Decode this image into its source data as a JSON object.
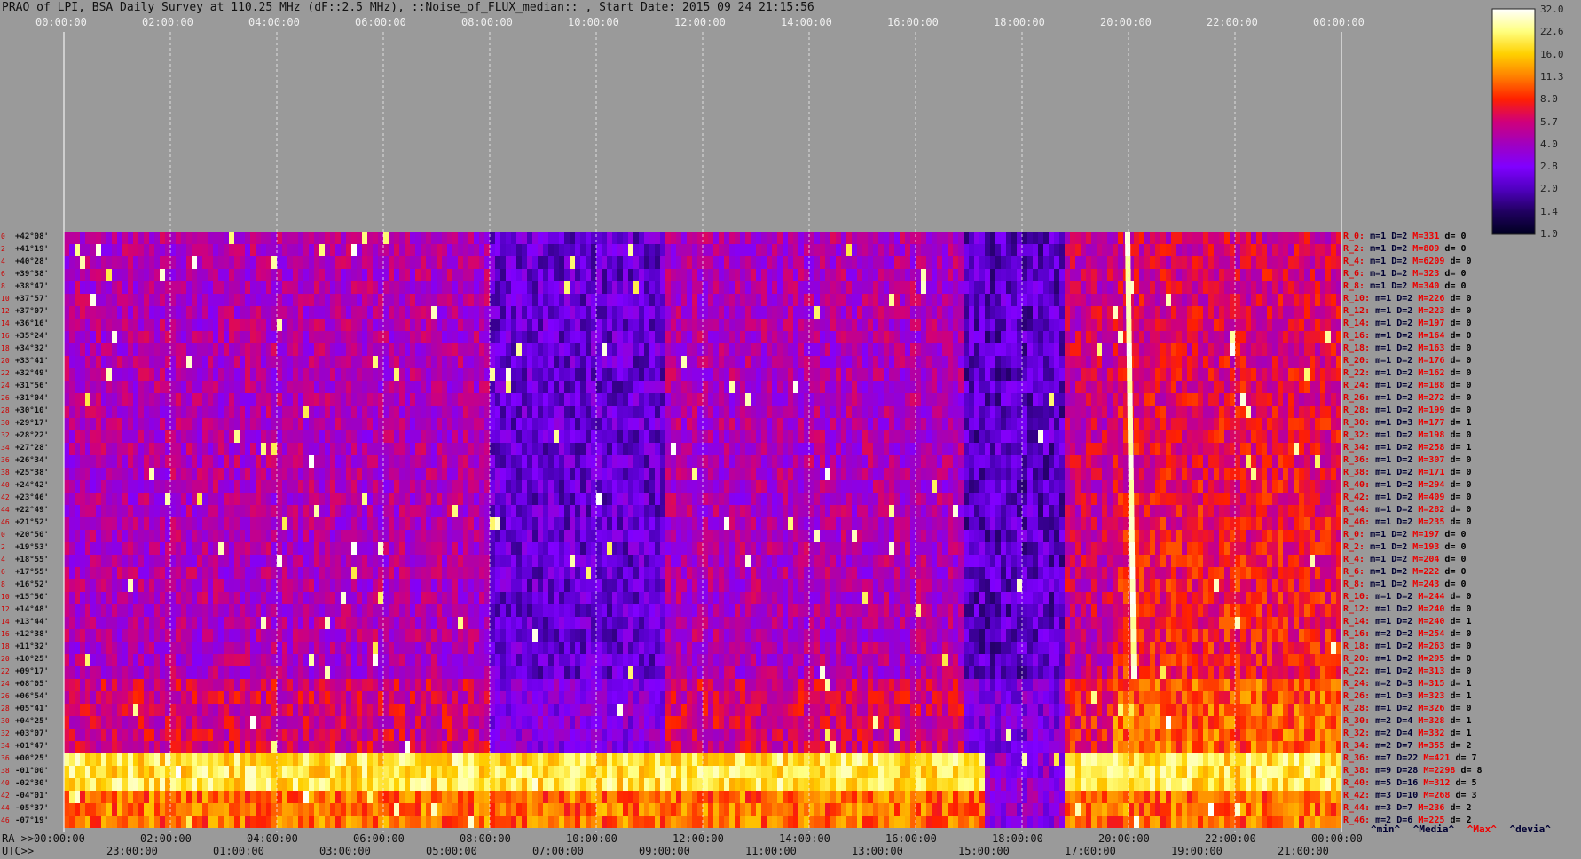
{
  "title": "PRAO of LPI, BSA Daily Survey at 110.25 MHz (dF::2.5 MHz), ::Noise_of_FLUX_median:: , Start Date: 2015 09 24 21:15:56",
  "top_axis_ticks": [
    "00:00:00",
    "02:00:00",
    "04:00:00",
    "06:00:00",
    "08:00:00",
    "10:00:00",
    "12:00:00",
    "14:00:00",
    "16:00:00",
    "18:00:00",
    "20:00:00",
    "22:00:00",
    "00:00:00"
  ],
  "bottom_axis": {
    "ra_prefix": "RA >>",
    "ra_ticks": [
      "00:00:00",
      "02:00:00",
      "04:00:00",
      "06:00:00",
      "08:00:00",
      "10:00:00",
      "12:00:00",
      "14:00:00",
      "16:00:00",
      "18:00:00",
      "20:00:00",
      "22:00:00",
      "00:00:00"
    ],
    "utc_prefix": "UTC>>",
    "utc_ticks": [
      "23:00:00",
      "01:00:00",
      "03:00:00",
      "05:00:00",
      "07:00:00",
      "09:00:00",
      "11:00:00",
      "13:00:00",
      "15:00:00",
      "17:00:00",
      "19:00:00",
      "21:00:00"
    ]
  },
  "row_numbers": [
    "0",
    "2",
    "4",
    "6",
    "8",
    "10",
    "12",
    "14",
    "16",
    "18",
    "20",
    "22",
    "24",
    "26",
    "28",
    "30",
    "32",
    "34",
    "36",
    "38",
    "40",
    "42",
    "44",
    "46",
    "0",
    "2",
    "4",
    "6",
    "8",
    "10",
    "12",
    "14",
    "16",
    "18",
    "20",
    "22",
    "24",
    "26",
    "28",
    "30",
    "32",
    "34",
    "36",
    "38",
    "40",
    "42",
    "44",
    "46"
  ],
  "declinations": [
    "+42°08'",
    "+41°19'",
    "+40°28'",
    "+39°38'",
    "+38°47'",
    "+37°57'",
    "+37°07'",
    "+36°16'",
    "+35°24'",
    "+34°32'",
    "+33°41'",
    "+32°49'",
    "+31°56'",
    "+31°04'",
    "+30°10'",
    "+29°17'",
    "+28°22'",
    "+27°28'",
    "+26°34'",
    "+25°38'",
    "+24°42'",
    "+23°46'",
    "+22°49'",
    "+21°52'",
    "+20°50'",
    "+19°53'",
    "+18°55'",
    "+17°55'",
    "+16°52'",
    "+15°50'",
    "+14°48'",
    "+13°44'",
    "+12°38'",
    "+11°32'",
    "+10°25'",
    "+09°17'",
    "+08°05'",
    "+06°54'",
    "+05°41'",
    "+04°25'",
    "+03°07'",
    "+01°47'",
    "+00°25'",
    "-01°00'",
    "-02°30'",
    "-04°01'",
    "-05°37'",
    "-07°19'"
  ],
  "stats": [
    {
      "r": "R_0:",
      "min": "m=1",
      "med": "D=2",
      "max": "M=331",
      "dev": "d= 0"
    },
    {
      "r": "R_2:",
      "min": "m=1",
      "med": "D=2",
      "max": "M=809",
      "dev": "d= 0"
    },
    {
      "r": "R_4:",
      "min": "m=1",
      "med": "D=2",
      "max": "M=6209",
      "dev": "d= 0"
    },
    {
      "r": "R_6:",
      "min": "m=1",
      "med": "D=2",
      "max": "M=323",
      "dev": "d= 0"
    },
    {
      "r": "R_8:",
      "min": "m=1",
      "med": "D=2",
      "max": "M=340",
      "dev": "d= 0"
    },
    {
      "r": "R_10:",
      "min": "m=1",
      "med": "D=2",
      "max": "M=226",
      "dev": "d= 0"
    },
    {
      "r": "R_12:",
      "min": "m=1",
      "med": "D=2",
      "max": "M=223",
      "dev": "d= 0"
    },
    {
      "r": "R_14:",
      "min": "m=1",
      "med": "D=2",
      "max": "M=197",
      "dev": "d= 0"
    },
    {
      "r": "R_16:",
      "min": "m=1",
      "med": "D=2",
      "max": "M=164",
      "dev": "d= 0"
    },
    {
      "r": "R_18:",
      "min": "m=1",
      "med": "D=2",
      "max": "M=163",
      "dev": "d= 0"
    },
    {
      "r": "R_20:",
      "min": "m=1",
      "med": "D=2",
      "max": "M=176",
      "dev": "d= 0"
    },
    {
      "r": "R_22:",
      "min": "m=1",
      "med": "D=2",
      "max": "M=162",
      "dev": "d= 0"
    },
    {
      "r": "R_24:",
      "min": "m=1",
      "med": "D=2",
      "max": "M=188",
      "dev": "d= 0"
    },
    {
      "r": "R_26:",
      "min": "m=1",
      "med": "D=2",
      "max": "M=272",
      "dev": "d= 0"
    },
    {
      "r": "R_28:",
      "min": "m=1",
      "med": "D=2",
      "max": "M=199",
      "dev": "d= 0"
    },
    {
      "r": "R_30:",
      "min": "m=1",
      "med": "D=3",
      "max": "M=177",
      "dev": "d= 1"
    },
    {
      "r": "R_32:",
      "min": "m=1",
      "med": "D=2",
      "max": "M=198",
      "dev": "d= 0"
    },
    {
      "r": "R_34:",
      "min": "m=1",
      "med": "D=2",
      "max": "M=258",
      "dev": "d= 1"
    },
    {
      "r": "R_36:",
      "min": "m=1",
      "med": "D=2",
      "max": "M=307",
      "dev": "d= 0"
    },
    {
      "r": "R_38:",
      "min": "m=1",
      "med": "D=2",
      "max": "M=171",
      "dev": "d= 0"
    },
    {
      "r": "R_40:",
      "min": "m=1",
      "med": "D=2",
      "max": "M=294",
      "dev": "d= 0"
    },
    {
      "r": "R_42:",
      "min": "m=1",
      "med": "D=2",
      "max": "M=409",
      "dev": "d= 0"
    },
    {
      "r": "R_44:",
      "min": "m=1",
      "med": "D=2",
      "max": "M=282",
      "dev": "d= 0"
    },
    {
      "r": "R_46:",
      "min": "m=1",
      "med": "D=2",
      "max": "M=235",
      "dev": "d= 0"
    },
    {
      "r": "R_0:",
      "min": "m=1",
      "med": "D=2",
      "max": "M=197",
      "dev": "d= 0"
    },
    {
      "r": "R_2:",
      "min": "m=1",
      "med": "D=2",
      "max": "M=193",
      "dev": "d= 0"
    },
    {
      "r": "R_4:",
      "min": "m=1",
      "med": "D=2",
      "max": "M=204",
      "dev": "d= 0"
    },
    {
      "r": "R_6:",
      "min": "m=1",
      "med": "D=2",
      "max": "M=222",
      "dev": "d= 0"
    },
    {
      "r": "R_8:",
      "min": "m=1",
      "med": "D=2",
      "max": "M=243",
      "dev": "d= 0"
    },
    {
      "r": "R_10:",
      "min": "m=1",
      "med": "D=2",
      "max": "M=244",
      "dev": "d= 0"
    },
    {
      "r": "R_12:",
      "min": "m=1",
      "med": "D=2",
      "max": "M=240",
      "dev": "d= 0"
    },
    {
      "r": "R_14:",
      "min": "m=1",
      "med": "D=2",
      "max": "M=240",
      "dev": "d= 1"
    },
    {
      "r": "R_16:",
      "min": "m=2",
      "med": "D=2",
      "max": "M=254",
      "dev": "d= 0"
    },
    {
      "r": "R_18:",
      "min": "m=1",
      "med": "D=2",
      "max": "M=263",
      "dev": "d= 0"
    },
    {
      "r": "R_20:",
      "min": "m=1",
      "med": "D=2",
      "max": "M=295",
      "dev": "d= 0"
    },
    {
      "r": "R_22:",
      "min": "m=1",
      "med": "D=2",
      "max": "M=313",
      "dev": "d= 0"
    },
    {
      "r": "R_24:",
      "min": "m=2",
      "med": "D=3",
      "max": "M=315",
      "dev": "d= 1"
    },
    {
      "r": "R_26:",
      "min": "m=1",
      "med": "D=3",
      "max": "M=323",
      "dev": "d= 1"
    },
    {
      "r": "R_28:",
      "min": "m=1",
      "med": "D=2",
      "max": "M=326",
      "dev": "d= 0"
    },
    {
      "r": "R_30:",
      "min": "m=2",
      "med": "D=4",
      "max": "M=328",
      "dev": "d= 1"
    },
    {
      "r": "R_32:",
      "min": "m=2",
      "med": "D=4",
      "max": "M=332",
      "dev": "d= 1"
    },
    {
      "r": "R_34:",
      "min": "m=2",
      "med": "D=7",
      "max": "M=355",
      "dev": "d= 2"
    },
    {
      "r": "R_36:",
      "min": "m=7",
      "med": "D=22",
      "max": "M=421",
      "dev": "d= 7"
    },
    {
      "r": "R_38:",
      "min": "m=9",
      "med": "D=28",
      "max": "M=2298",
      "dev": "d= 8"
    },
    {
      "r": "R_40:",
      "min": "m=5",
      "med": "D=16",
      "max": "M=312",
      "dev": "d= 5"
    },
    {
      "r": "R_42:",
      "min": "m=3",
      "med": "D=10",
      "max": "M=268",
      "dev": "d= 3"
    },
    {
      "r": "R_44:",
      "min": "m=3",
      "med": "D=7",
      "max": "M=236",
      "dev": "d= 2"
    },
    {
      "r": "R_46:",
      "min": "m=2",
      "med": "D=6",
      "max": "M=225",
      "dev": "d= 2"
    }
  ],
  "legend": {
    "min": "^min^",
    "median": "^Media^",
    "max": "^Max^",
    "dev": "^devia^"
  },
  "colorbar": {
    "ticks": [
      "32.0",
      "22.6",
      "16.0",
      "11.3",
      "8.0",
      "5.7",
      "4.0",
      "2.8",
      "2.0",
      "1.4",
      "1.0"
    ],
    "colors": [
      "#ffffff",
      "#ffff80",
      "#ffd000",
      "#ff8000",
      "#ff2000",
      "#d0007a",
      "#a000c0",
      "#8000ff",
      "#5000c0",
      "#200060",
      "#000020"
    ]
  },
  "chart_data": {
    "type": "heatmap",
    "title": "PRAO of LPI, BSA Daily Survey at 110.25 MHz (dF::2.5 MHz), ::Noise_of_FLUX_median:: , Start Date: 2015 09 24 21:15:56",
    "x_axis_top": [
      "00:00:00",
      "02:00:00",
      "04:00:00",
      "06:00:00",
      "08:00:00",
      "10:00:00",
      "12:00:00",
      "14:00:00",
      "16:00:00",
      "18:00:00",
      "20:00:00",
      "22:00:00",
      "00:00:00"
    ],
    "y_axis": "declinations",
    "color_scale": "log",
    "value_range": [
      1.0,
      32.0
    ],
    "colorbar_ticks": [
      32.0,
      22.6,
      16.0,
      11.3,
      8.0,
      5.7,
      4.0,
      2.8,
      2.0,
      1.4,
      1.0
    ]
  }
}
